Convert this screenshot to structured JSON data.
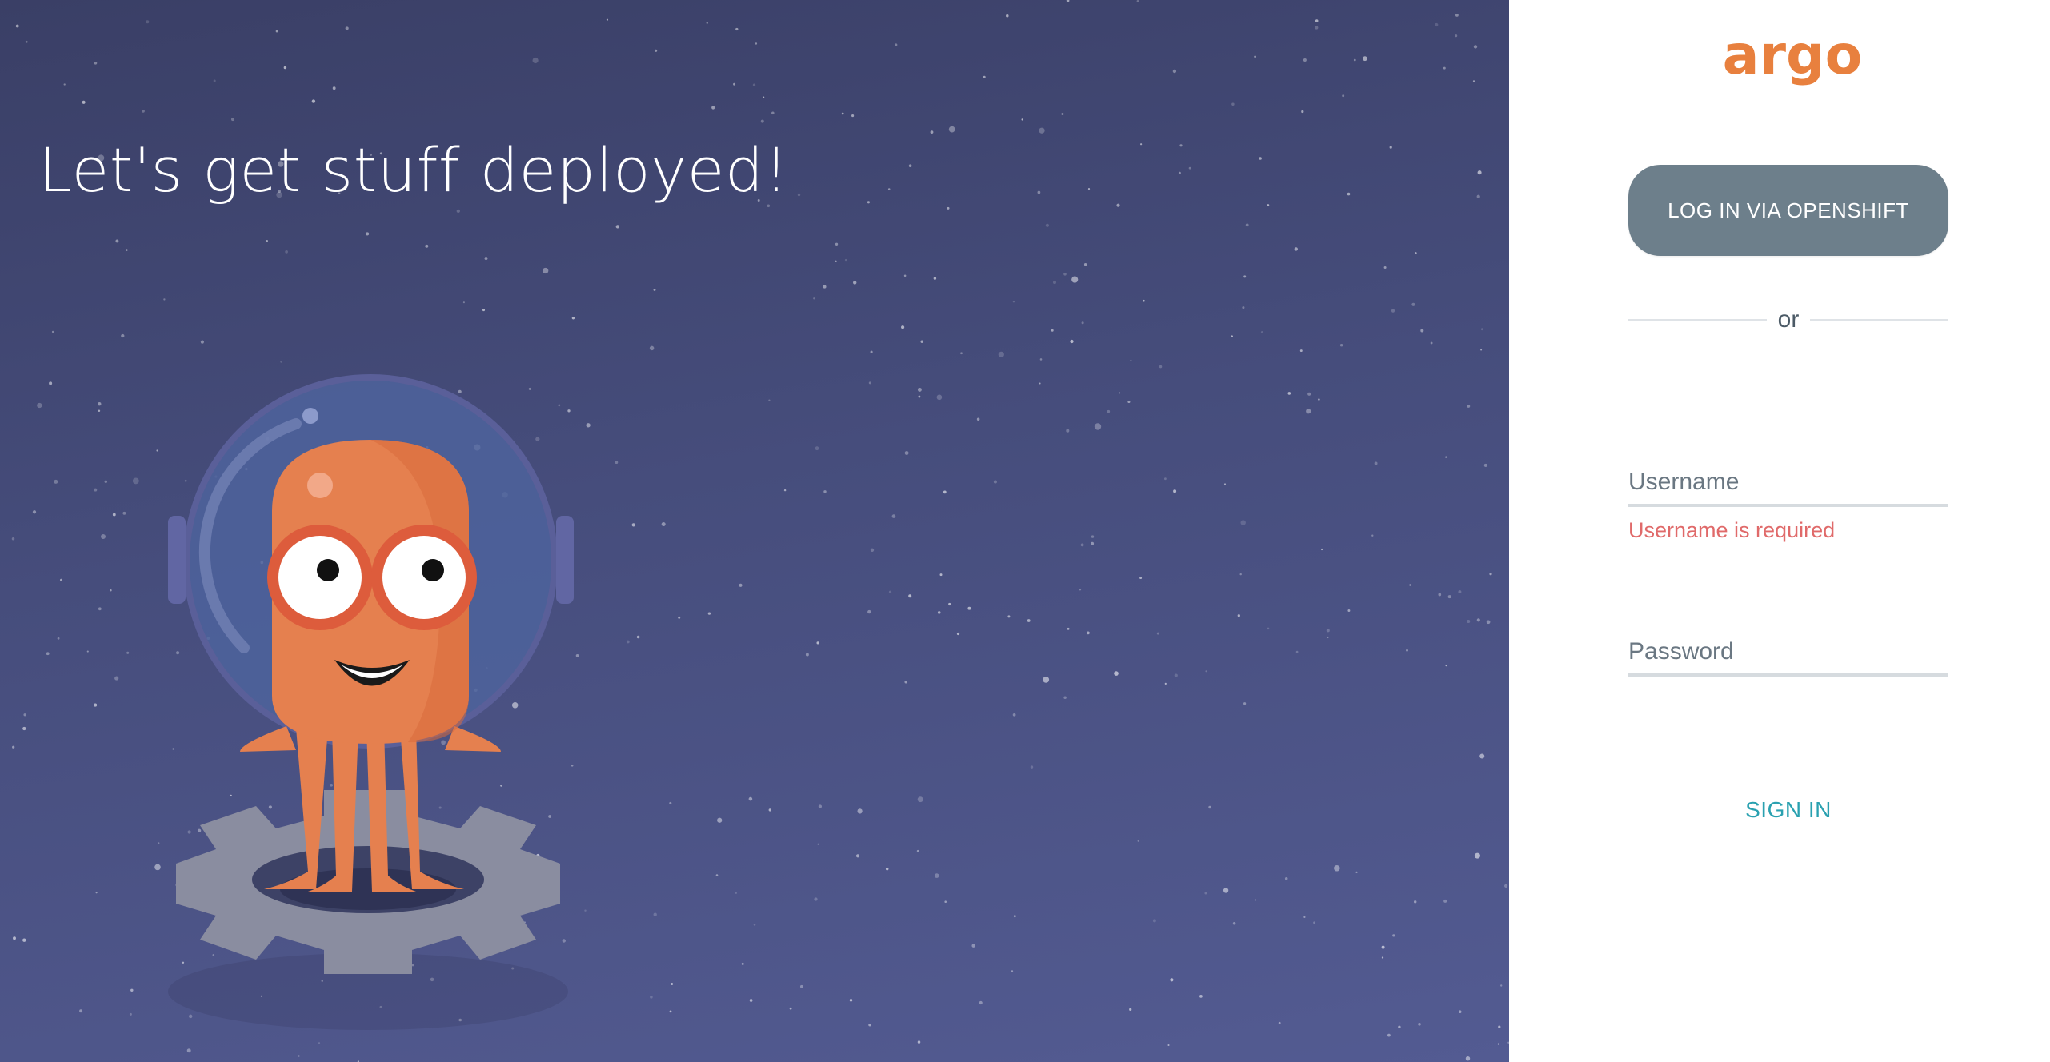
{
  "hero": {
    "headline": "Let's get stuff deployed!",
    "mascot_icon": "argo-octopus-astronaut-icon",
    "background_colors": [
      "#3a3f66",
      "#535b92"
    ]
  },
  "login": {
    "logo_text": "argo",
    "logo_color": "#e8803e",
    "sso_button_label": "LOG IN VIA OPENSHIFT",
    "divider_text": "or",
    "username": {
      "placeholder": "Username",
      "value": "",
      "error": "Username is required"
    },
    "password": {
      "placeholder": "Password",
      "value": ""
    },
    "sign_in_label": "SIGN IN",
    "accent_color": "#2aa1b0",
    "error_color": "#e06a6a"
  }
}
